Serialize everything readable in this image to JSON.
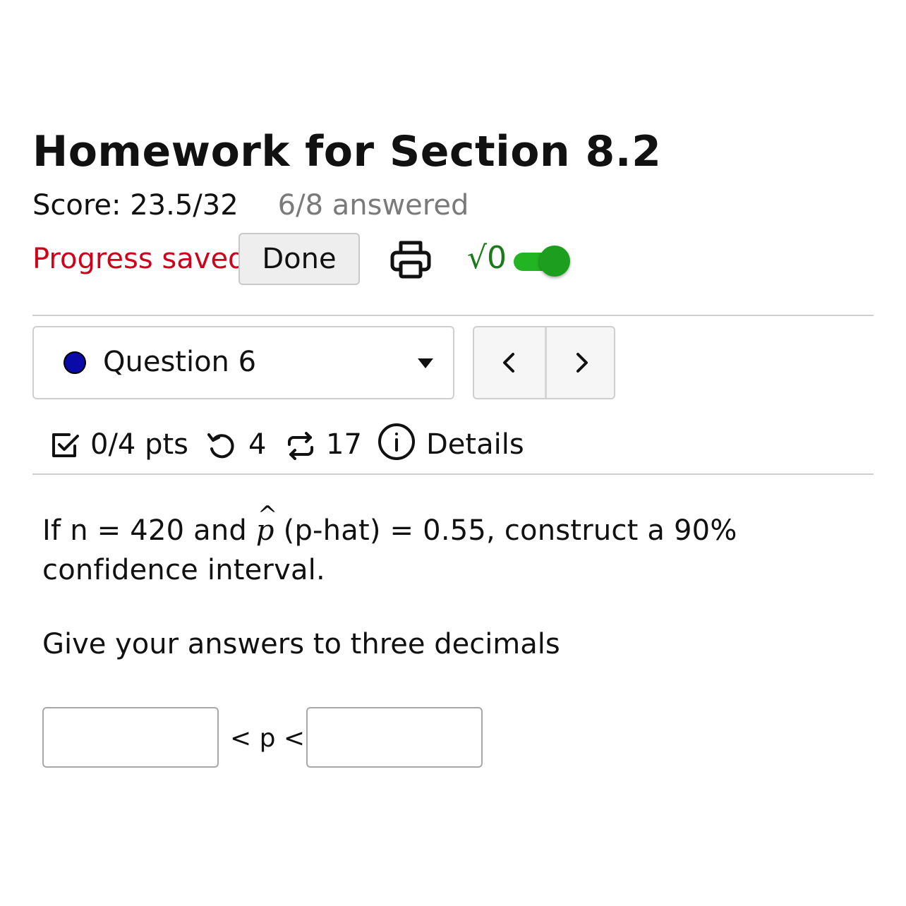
{
  "header": {
    "title": "Homework for Section 8.2",
    "score": "Score: 23.5/32",
    "answered": "6/8 answered",
    "progress_status": "Progress saved",
    "done_label": "Done",
    "math_toggle_label": "√0",
    "math_toggle_on": true
  },
  "question_nav": {
    "selected_question": "Question 6",
    "status_color": "#0a0aa8",
    "prev_label": "<",
    "next_label": ">"
  },
  "meta": {
    "points": "0/4 pts",
    "retries": "4",
    "versions": "17",
    "details_label": "Details"
  },
  "question": {
    "text_before": "If n = 420 and ",
    "phat_symbol": "p",
    "text_after": " (p-hat) = 0.55, construct a 90% confidence interval.",
    "instruction": "Give your answers to three decimals",
    "between_label": "< p <",
    "lower_value": "",
    "upper_value": ""
  },
  "colors": {
    "status_red": "#d0021b",
    "toggle_green": "#1e9e1e",
    "answered_gray": "#7a7a7a"
  }
}
